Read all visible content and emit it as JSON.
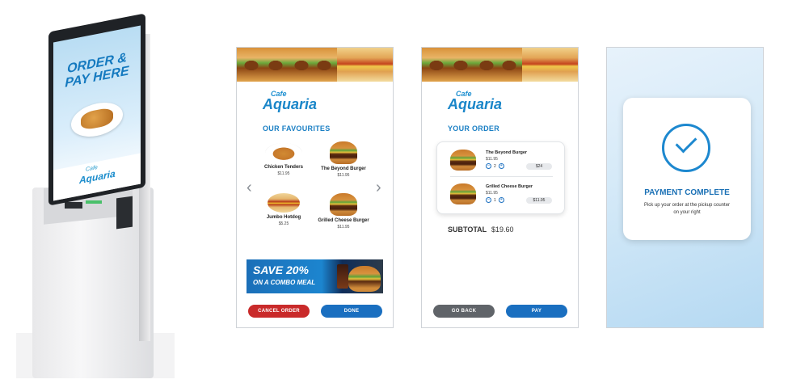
{
  "kiosk": {
    "headline": "ORDER & PAY HERE",
    "brand_prefix": "Cafe",
    "brand_name": "Aquaria"
  },
  "screen1": {
    "brand_prefix": "Cafe",
    "brand_name": "Aquaria",
    "section_title": "OUR FAVOURITES",
    "items": [
      {
        "name": "Chicken Tenders",
        "price": "$11.95",
        "icon": "chicken-tenders"
      },
      {
        "name": "The Beyond Burger",
        "price": "$11.95",
        "icon": "burger"
      },
      {
        "name": "Jumbo Hotdog",
        "price": "$5.25",
        "icon": "hotdog"
      },
      {
        "name": "Grilled Cheese Burger",
        "price": "$11.95",
        "icon": "burger"
      }
    ],
    "prev_arrow": "‹",
    "next_arrow": "›",
    "promo_line1": "SAVE 20%",
    "promo_line2": "ON A COMBO MEAL",
    "cancel_label": "CANCEL ORDER",
    "done_label": "DONE"
  },
  "screen2": {
    "brand_prefix": "Cafe",
    "brand_name": "Aquaria",
    "section_title": "YOUR ORDER",
    "order": [
      {
        "name": "The Beyond Burger",
        "price": "$11.95",
        "qty": "2",
        "total": "$24"
      },
      {
        "name": "Grilled Cheese Burger",
        "price": "$11.95",
        "qty": "1",
        "total": "$11.95"
      }
    ],
    "minus": "–",
    "plus": "+",
    "subtotal_label": "SUBTOTAL",
    "subtotal_value": "$19.60",
    "back_label": "GO BACK",
    "pay_label": "PAY"
  },
  "screen3": {
    "title": "PAYMENT COMPLETE",
    "message": "Pick up your order at the pickup counter on your right"
  },
  "colors": {
    "brand_blue": "#1a6fc0",
    "cancel_red": "#c92a2a",
    "back_grey": "#606469"
  }
}
